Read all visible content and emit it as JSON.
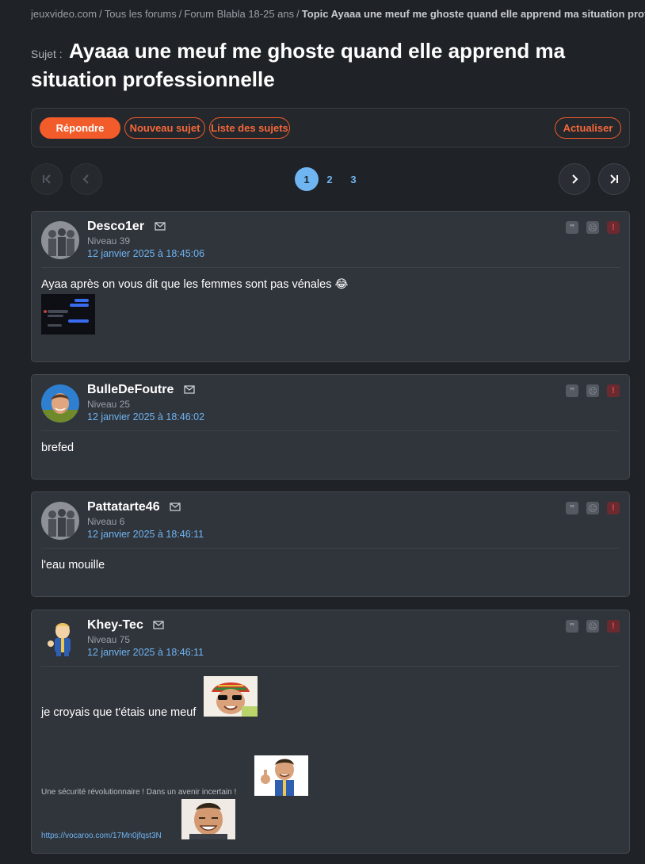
{
  "breadcrumb": {
    "site": "jeuxvideo.com",
    "forums": "Tous les forums",
    "forum": "Forum Blabla 18-25 ans",
    "topic": "Topic Ayaaa une meuf me ghoste quand elle apprend ma situation professionnelle"
  },
  "title": {
    "prefix": "Sujet :",
    "text": "Ayaaa une meuf me ghoste quand elle apprend ma situation professionnelle"
  },
  "actions": {
    "reply": "Répondre",
    "new_topic": "Nouveau sujet",
    "topic_list": "Liste des sujets",
    "refresh": "Actualiser"
  },
  "pagination": {
    "pages": [
      "1",
      "2",
      "3"
    ],
    "current": "1"
  },
  "colors": {
    "accent": "#f25c2a",
    "link": "#6fb5f2",
    "report": "#e14b4b"
  },
  "posts": [
    {
      "author": "Desco1er",
      "level": "Niveau 39",
      "date": "12 janvier 2025 à 18:45:06",
      "text": "Ayaa après on vous dit que les femmes sont pas vénales",
      "emoji": "😂"
    },
    {
      "author": "BulleDeFoutre",
      "level": "Niveau 25",
      "date": "12 janvier 2025 à 18:46:02",
      "text": "brefed"
    },
    {
      "author": "Pattatarte46",
      "level": "Niveau 6",
      "date": "12 janvier 2025 à 18:46:11",
      "text": "l'eau mouille"
    },
    {
      "author": "Khey-Tec",
      "level": "Niveau 75",
      "date": "12 janvier 2025 à 18:46:11",
      "text": "je croyais que t'étais une meuf",
      "signature": "Une sécurité révolutionnaire ! Dans un avenir incertain !",
      "link": "https://vocaroo.com/17Mn0jfqst3N"
    }
  ]
}
